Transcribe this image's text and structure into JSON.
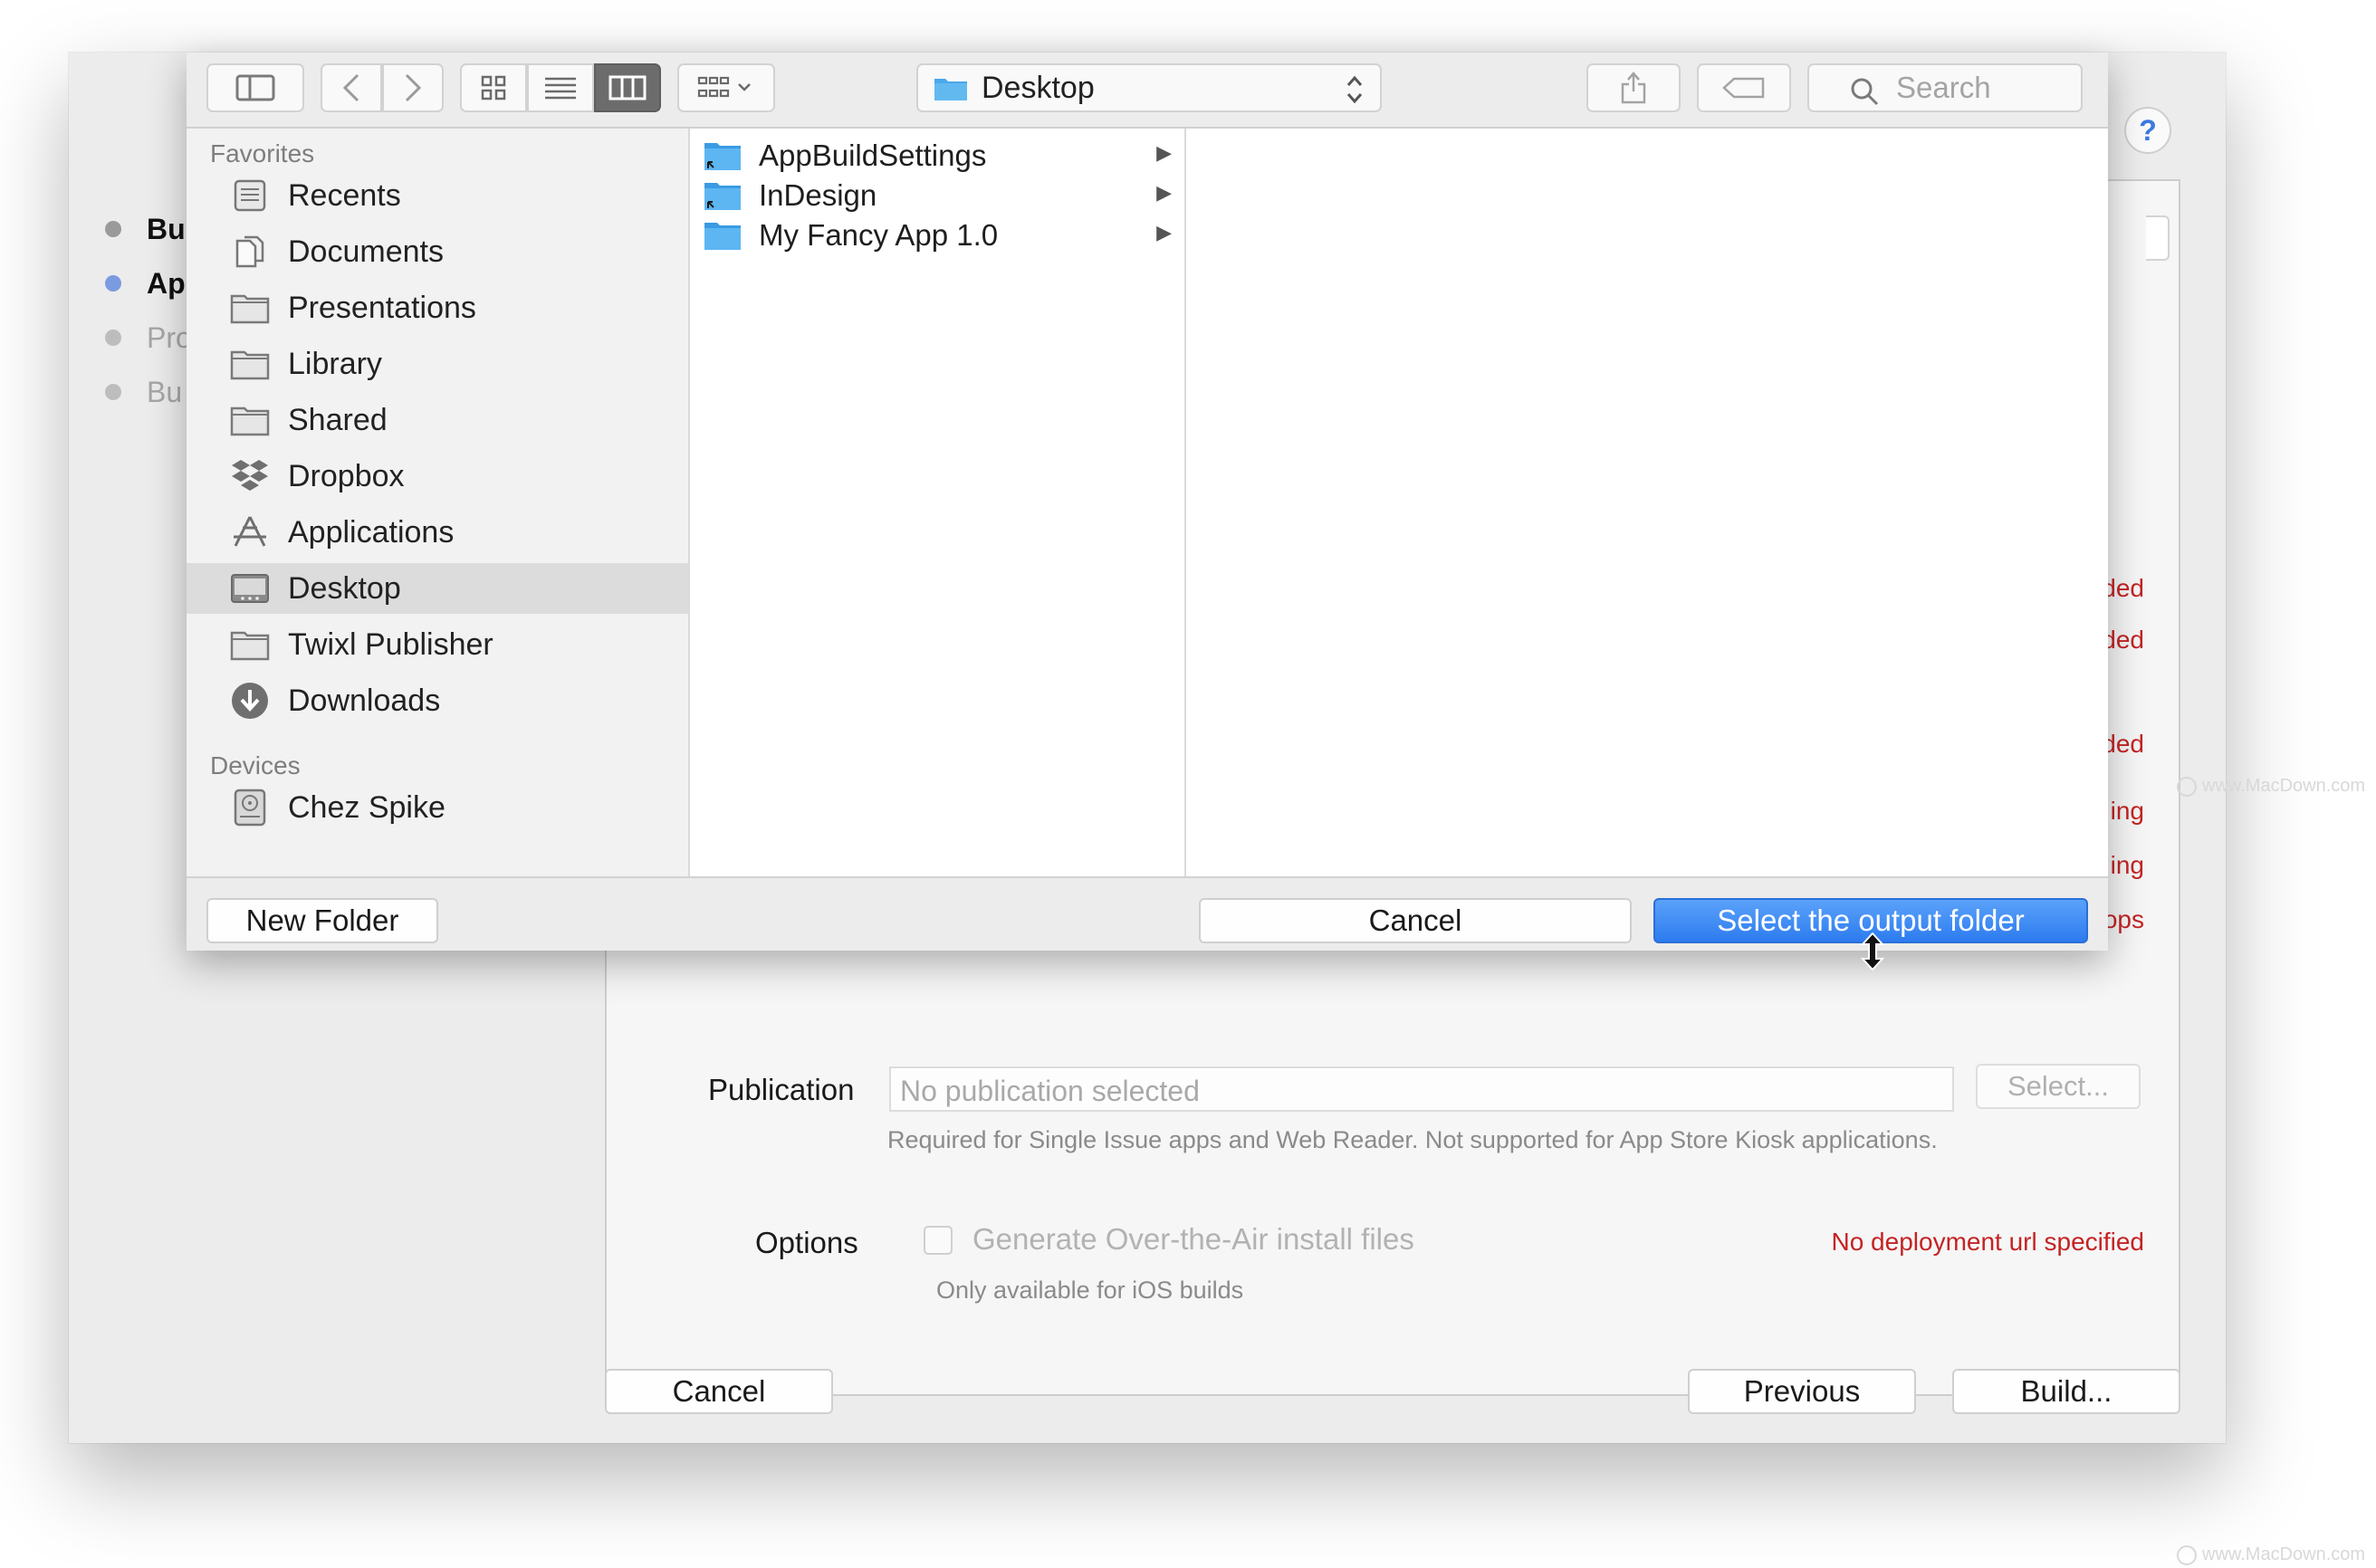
{
  "background_window": {
    "steps": [
      {
        "label": "Bu",
        "state": "done"
      },
      {
        "label": "Ap",
        "state": "active"
      },
      {
        "label": "Pro",
        "state": "pending"
      },
      {
        "label": "Bu",
        "state": "pending"
      }
    ],
    "help_label": "?",
    "errors": [
      "ded",
      "ded",
      "ded",
      "ing",
      "ing",
      "ops"
    ],
    "publication": {
      "label": "Publication",
      "placeholder": "No publication selected",
      "select_button": "Select...",
      "hint": "Required for Single Issue apps and Web Reader. Not supported for App Store Kiosk applications."
    },
    "options": {
      "label": "Options",
      "checkbox_label": "Generate Over-the-Air install files",
      "checked": false,
      "hint": "Only available for iOS builds",
      "error": "No deployment url specified"
    },
    "buttons": {
      "cancel": "Cancel",
      "previous": "Previous",
      "build": "Build..."
    }
  },
  "dialog": {
    "toolbar": {
      "location": "Desktop",
      "search_placeholder": "Search",
      "view_mode": "columns"
    },
    "sidebar": {
      "favorites_header": "Favorites",
      "favorites": [
        {
          "label": "Recents",
          "icon": "recents-icon"
        },
        {
          "label": "Documents",
          "icon": "documents-icon"
        },
        {
          "label": "Presentations",
          "icon": "folder-icon"
        },
        {
          "label": "Library",
          "icon": "folder-icon"
        },
        {
          "label": "Shared",
          "icon": "folder-icon"
        },
        {
          "label": "Dropbox",
          "icon": "dropbox-icon"
        },
        {
          "label": "Applications",
          "icon": "applications-icon"
        },
        {
          "label": "Desktop",
          "icon": "desktop-icon",
          "selected": true
        },
        {
          "label": "Twixl Publisher",
          "icon": "folder-icon"
        },
        {
          "label": "Downloads",
          "icon": "downloads-icon"
        }
      ],
      "devices_header": "Devices",
      "devices": [
        {
          "label": "Chez Spike",
          "icon": "disk-icon"
        }
      ]
    },
    "columns": [
      {
        "items": [
          {
            "label": "AppBuildSettings",
            "icon": "folder-alias-icon"
          },
          {
            "label": "InDesign",
            "icon": "folder-alias-icon"
          },
          {
            "label": "My Fancy App 1.0",
            "icon": "folder-icon"
          }
        ]
      }
    ],
    "footer": {
      "new_folder": "New Folder",
      "cancel": "Cancel",
      "confirm": "Select the output folder"
    }
  },
  "watermarks": [
    "www.MacDown.com",
    "www.MacDown.com"
  ],
  "colors": {
    "accent": "#2d7bef",
    "error": "#c42323",
    "active_dot": "#7a9be0",
    "folder": "#4aa8ea"
  }
}
